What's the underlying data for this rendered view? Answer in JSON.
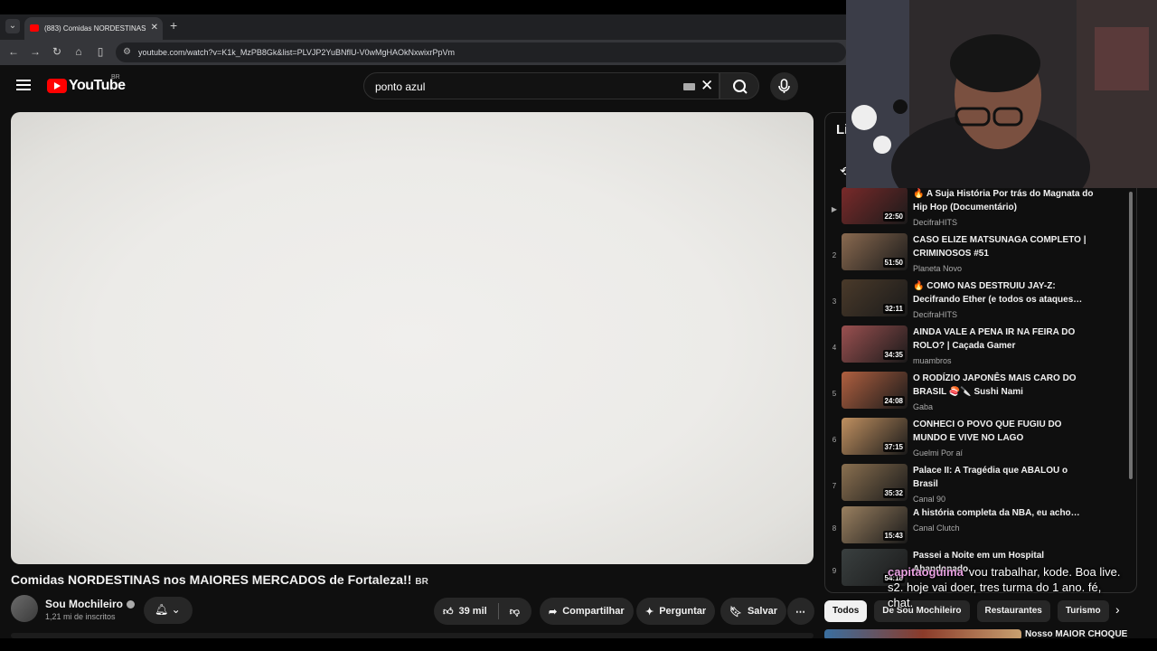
{
  "browser": {
    "tab_title": "(883) Comidas NORDESTINAS",
    "url": "youtube.com/watch?v=K1k_MzPB8Gk&list=PLVJP2YuBNflU-V0wMgHAOkNxwixrPpVm"
  },
  "header": {
    "logo_text": "YouTube",
    "country_code": "BR",
    "search_value": "ponto azul"
  },
  "video": {
    "title": "Comidas NORDESTINAS nos MAIORES MERCADOS de Fortaleza!!",
    "title_badge": "BR",
    "channel_name": "Sou Mochileiro",
    "subscribers": "1,21 mi de inscritos",
    "likes": "39 mil",
    "share_label": "Compartilhar",
    "ask_label": "Perguntar",
    "save_label": "Salvar"
  },
  "playlist": {
    "header": "Li",
    "items": [
      {
        "index": "▶",
        "title": "🔥 A Suja História Por trás do Magnata do Hip Hop (Documentário)",
        "channel": "DecifraHITS",
        "duration": "22:50",
        "color": "#7a2a2a"
      },
      {
        "index": "2",
        "title": "CASO ELIZE MATSUNAGA COMPLETO | CRIMINOSOS #51",
        "channel": "Planeta Novo",
        "duration": "51:50",
        "color": "#8a6a50"
      },
      {
        "index": "3",
        "title": "🔥 COMO NAS DESTRUIU JAY-Z: Decifrando Ether (e todos os ataques…",
        "channel": "DecifraHITS",
        "duration": "32:11",
        "color": "#4a3a2a"
      },
      {
        "index": "4",
        "title": "AINDA VALE A PENA IR NA FEIRA DO ROLO? | Caçada Gamer",
        "channel": "muambros",
        "duration": "34:35",
        "color": "#9a5050"
      },
      {
        "index": "5",
        "title": "O RODÍZIO JAPONÊS MAIS CARO DO BRASIL 🍣🔪 Sushi Nami",
        "channel": "Gaba",
        "duration": "24:08",
        "color": "#b06040"
      },
      {
        "index": "6",
        "title": "CONHECI O POVO QUE FUGIU DO MUNDO E VIVE NO LAGO",
        "channel": "Guelmi Por aí",
        "duration": "37:15",
        "color": "#c09060"
      },
      {
        "index": "7",
        "title": "Palace II: A Tragédia que ABALOU o Brasil",
        "channel": "Canal 90",
        "duration": "35:32",
        "color": "#8a7050"
      },
      {
        "index": "8",
        "title": "A história completa da NBA, eu acho…",
        "channel": "Canal Clutch",
        "duration": "15:43",
        "color": "#9a8060"
      },
      {
        "index": "9",
        "title": "Passei a Noite em um Hospital Abandonado",
        "channel": "",
        "duration": "54:18",
        "color": "#3a4040"
      }
    ]
  },
  "chips": [
    "Todos",
    "De Sou Mochileiro",
    "Restaurantes",
    "Turismo"
  ],
  "recommendation": {
    "title": "Nosso MAIOR CHOQUE"
  },
  "chat": {
    "user": "capitaoguima",
    "message": "vou trabalhar, kode. Boa live. s2. hoje vai doer, tres turma do 1 ano. fé, chat."
  }
}
